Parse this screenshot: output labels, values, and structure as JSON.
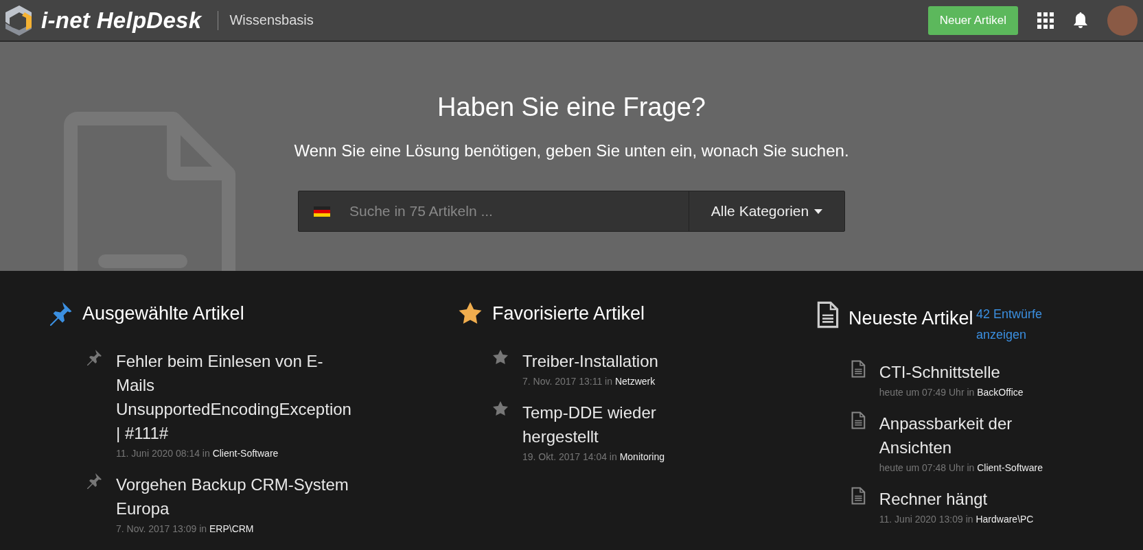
{
  "header": {
    "logo_text": "i-net HelpDesk",
    "section": "Wissensbasis",
    "new_button": "Neuer Artikel"
  },
  "hero": {
    "title": "Haben Sie eine Frage?",
    "subtitle": "Wenn Sie eine Lösung benötigen, geben Sie unten ein, wonach Sie suchen.",
    "search": {
      "placeholder": "Suche in 75 Artikeln ..."
    },
    "category_dropdown": "Alle Kategorien"
  },
  "columns": [
    {
      "kind": "pinned",
      "title": "Ausgewählte Artikel",
      "items": [
        {
          "title": "Fehler beim Einlesen von E-Mails UnsupportedEncodingException | #111#",
          "date": "11. Juni 2020 08:14 in",
          "category": "Client-Software"
        },
        {
          "title": "Vorgehen Backup CRM-System Europa",
          "date": "7. Nov. 2017 13:09 in",
          "category": "ERP\\CRM"
        }
      ]
    },
    {
      "kind": "favorite",
      "title": "Favorisierte Artikel",
      "items": [
        {
          "title": "Treiber-Installation",
          "date": "7. Nov. 2017 13:11 in",
          "category": "Netzwerk"
        },
        {
          "title": "Temp-DDE wieder hergestellt",
          "date": "19. Okt. 2017 14:04 in",
          "category": "Monitoring"
        }
      ]
    },
    {
      "kind": "newest",
      "title": "Neueste Artikel",
      "link": "42 Entwürfe anzeigen",
      "items": [
        {
          "title": "CTI-Schnittstelle",
          "date": "heute um 07:49 Uhr in",
          "category": "BackOffice"
        },
        {
          "title": "Anpassbarkeit der Ansichten",
          "date": "heute um 07:48 Uhr in",
          "category": "Client-Software"
        },
        {
          "title": "Rechner hängt",
          "date": "11. Juni 2020 13:09 in",
          "category": "Hardware\\PC"
        }
      ]
    }
  ]
}
